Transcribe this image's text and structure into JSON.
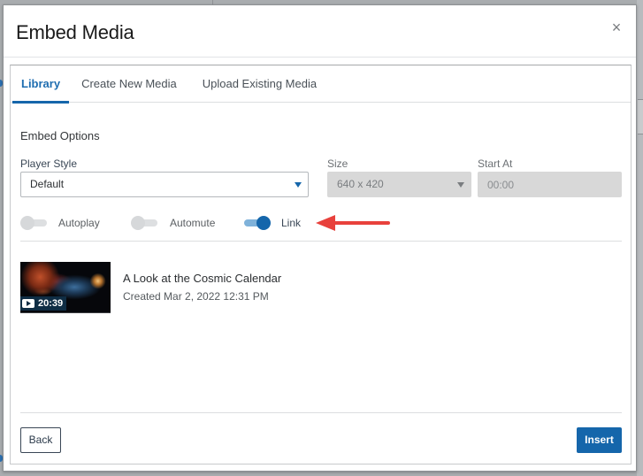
{
  "dialog": {
    "title": "Embed Media",
    "close_icon": "close-icon"
  },
  "tabs": [
    {
      "label": "Library",
      "active": true
    },
    {
      "label": "Create New Media",
      "active": false
    },
    {
      "label": "Upload Existing Media",
      "active": false
    }
  ],
  "embed_options": {
    "title": "Embed Options",
    "player_style": {
      "label": "Player Style",
      "value": "Default"
    },
    "size": {
      "label": "Size",
      "value": "640 x 420",
      "disabled": true
    },
    "start_at": {
      "label": "Start At",
      "value": "00:00",
      "disabled": true
    },
    "toggles": [
      {
        "label": "Autoplay",
        "on": false
      },
      {
        "label": "Automute",
        "on": false
      },
      {
        "label": "Link",
        "on": true
      }
    ]
  },
  "annotation": {
    "type": "arrow",
    "color": "#e8413c",
    "points_to": "Link"
  },
  "media_list": [
    {
      "title": "A Look at the Cosmic Calendar",
      "created": "Created Mar 2, 2022 12:31 PM",
      "duration": "20:39",
      "icon": "play-icon"
    }
  ],
  "footer": {
    "back_label": "Back",
    "insert_label": "Insert"
  },
  "colors": {
    "accent": "#1566ab",
    "toggle_on_track": "#7fb2da",
    "disabled_field": "#d8d8d8"
  }
}
